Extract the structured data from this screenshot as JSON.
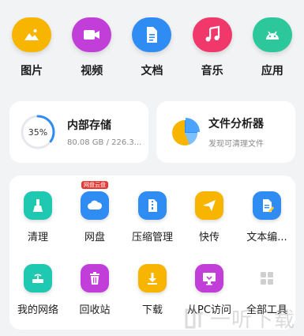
{
  "categories": [
    {
      "label": "图片",
      "icon": "image-icon",
      "color": "#f7b500"
    },
    {
      "label": "视频",
      "icon": "video-icon",
      "color": "#c23ed8"
    },
    {
      "label": "文档",
      "icon": "document-icon",
      "color": "#2f8cf2"
    },
    {
      "label": "音乐",
      "icon": "music-icon",
      "color": "#f0386b"
    },
    {
      "label": "应用",
      "icon": "android-icon",
      "color": "#2cc79b"
    }
  ],
  "storage": {
    "title": "内部存储",
    "percent_label": "35%",
    "percent": 35,
    "usage": "80.08 GB / 226.3...",
    "ring_color": "#2f8cf2"
  },
  "analyzer": {
    "title": "文件分析器",
    "subtitle": "发现可清理文件",
    "icon": "pie-chart-icon"
  },
  "tools": [
    {
      "label": "清理",
      "icon": "broom-icon",
      "color": "#1fc8b0"
    },
    {
      "label": "网盘",
      "icon": "cloud-drive-icon",
      "color": "#2f8cf2",
      "badge": "网盘云盘"
    },
    {
      "label": "压缩管理",
      "icon": "zip-icon",
      "color": "#2f8cf2"
    },
    {
      "label": "快传",
      "icon": "paper-plane-icon",
      "color": "#f7b500"
    },
    {
      "label": "文本编...",
      "icon": "text-edit-icon",
      "color": "#2f8cf2"
    },
    {
      "label": "我的网络",
      "icon": "router-icon",
      "color": "#1fc8b0"
    },
    {
      "label": "回收站",
      "icon": "trash-icon",
      "color": "#c23ed8"
    },
    {
      "label": "下载",
      "icon": "download-icon",
      "color": "#f7b500"
    },
    {
      "label": "从PC访问",
      "icon": "pc-access-icon",
      "color": "#c23ed8"
    },
    {
      "label": "全部工具",
      "icon": "grid-icon",
      "color": "#d0d0d0"
    }
  ],
  "watermark": {
    "text": "一听下载"
  }
}
